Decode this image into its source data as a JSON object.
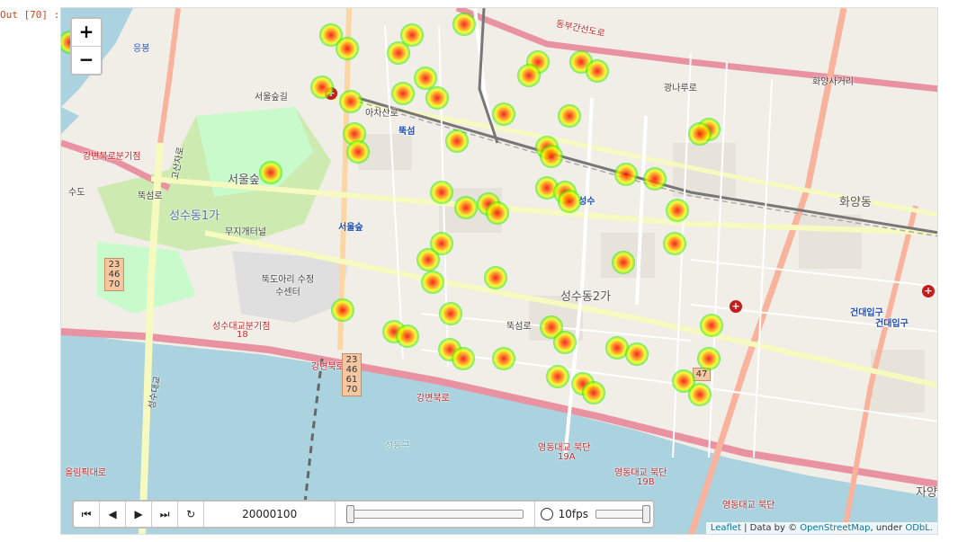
{
  "cell_label": "Out [70] :",
  "zoom": {
    "in": "+",
    "out": "−"
  },
  "labels": {
    "seoul_forest_park": "서울숲",
    "seongsu1ga": "성수동1가",
    "seongsu2ga": "성수동2가",
    "hwayang": "화양동",
    "ttukseom_station": "뚝섬",
    "seongsu_station": "성수",
    "seoulforest_station": "서울숲",
    "konkuk_station": "건대입구",
    "konkuk_station2": "건대입구",
    "gangbyeon_north_jct": "강변북로분기점",
    "seongsu_bridge_jct": "성수대교분기점",
    "yeongdong_north": "영동대교 북단",
    "yeongdong_north2": "영동대교 북단",
    "yeongdong_north3": "영동대교 북단",
    "olympic_rd": "올림픽대로",
    "dongbu_rd": "동부간선도로",
    "gangbyeon_rd": "강변북로",
    "gangbyeon_rd2": "강변북로",
    "gwangnaru_rd": "광나루로",
    "achasan_rd": "아차산로",
    "ttukseom_rd": "뚝섬로",
    "ttukseom_rd2": "뚝섬로",
    "seongsu_bridge": "성수대교",
    "goesan_rd": "고산자로",
    "muji_gate": "무지개터널",
    "seoulsup_gil": "서울숲길",
    "hwayang_4": "화양사거리",
    "ttukdo": "뚝도아리 수정수센터",
    "eungbong": "응봉",
    "sudo": "수도",
    "jayang": "자양",
    "nineteen_a": "19A",
    "nineteen_b": "19B",
    "eighteen": "18",
    "seongdong_gu": "성동구"
  },
  "shields": [
    "23\n46\n70",
    "23\n46\n61\n70",
    "47"
  ],
  "controls": {
    "btn_first": "⏮",
    "btn_prev": "◀",
    "btn_play": "▶",
    "btn_last": "⏭",
    "btn_loop": "↻",
    "timestamp": "20000100",
    "fps_label": "10fps",
    "time_position": 0,
    "fps_position": 1
  },
  "attribution": {
    "leaflet": "Leaflet",
    "sep": " | Data by © ",
    "osm": "OpenStreetMap",
    "under": ", under ",
    "odbl": "ODbL."
  },
  "colors": {
    "water": "#aad3df",
    "park": "#c8facc",
    "motorway": "#e892a2",
    "trunk": "#f9b29c",
    "rail": "#999999",
    "heat_core": "#ff0000",
    "heat_mid": "#ffff00",
    "heat_edge": "#00ff00"
  }
}
